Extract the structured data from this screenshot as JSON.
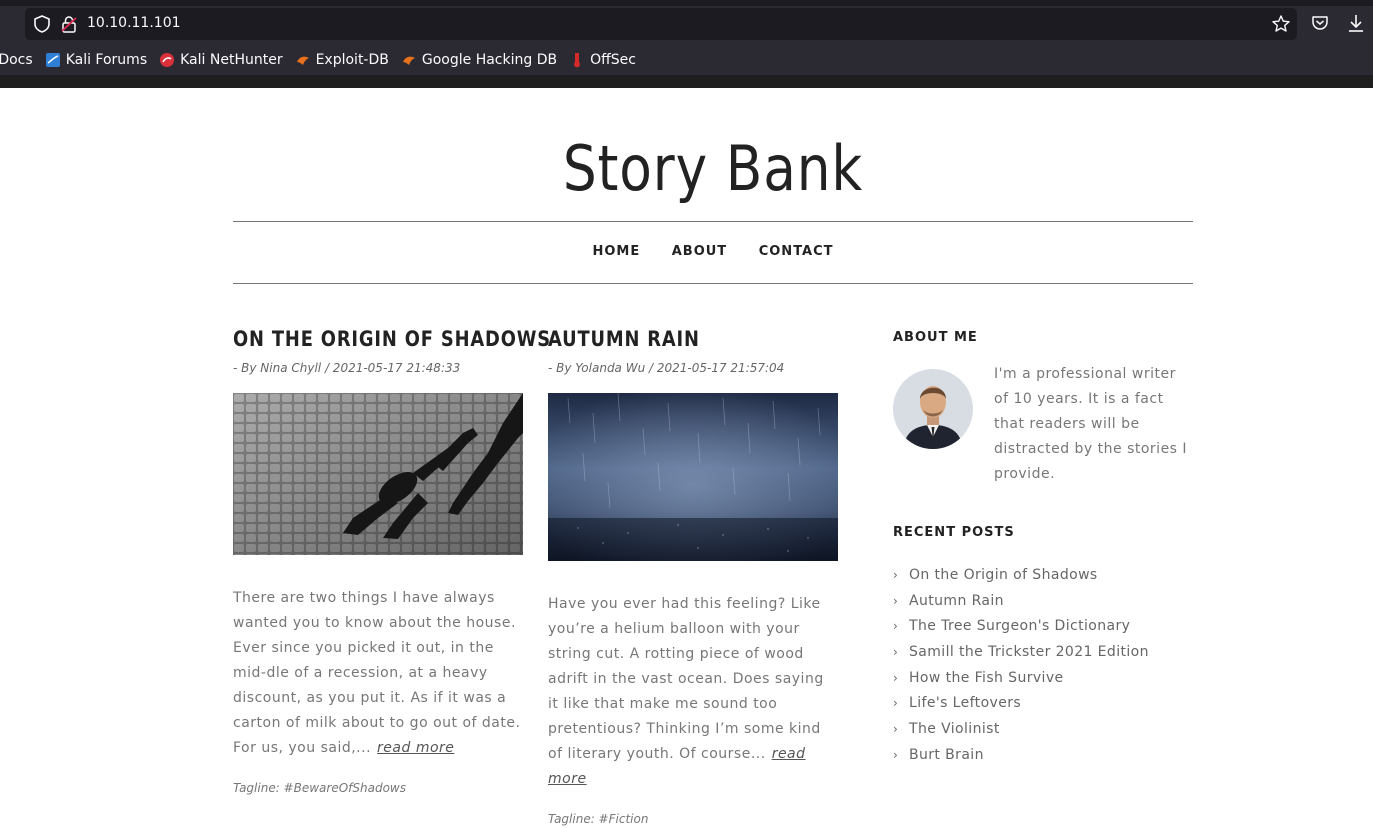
{
  "browser": {
    "url": "10.10.11.101",
    "bookmarks": [
      {
        "label": "i Docs",
        "icon": "kali-docs-icon"
      },
      {
        "label": "Kali Forums",
        "icon": "kali-forums-icon"
      },
      {
        "label": "Kali NetHunter",
        "icon": "kali-nethunter-icon"
      },
      {
        "label": "Exploit-DB",
        "icon": "exploit-db-icon"
      },
      {
        "label": "Google Hacking DB",
        "icon": "ghdb-icon"
      },
      {
        "label": "OffSec",
        "icon": "offsec-icon"
      }
    ]
  },
  "site": {
    "title": "Story Bank",
    "nav": [
      "HOME",
      "ABOUT",
      "CONTACT"
    ]
  },
  "posts": [
    {
      "title": "ON THE ORIGIN OF SHADOWS",
      "meta": "- By Nina Chyll / 2021-05-17 21:48:33",
      "body": "There are two things I have always wanted you to know about the house. Ever since you picked it out, in the mid-dle of a recession, at a heavy discount, as you put it. As if it was a carton of milk about to go out of date. For us, you said,...",
      "more": "read more",
      "tag": "Tagline: #BewareOfShadows",
      "image": "shadow-couple-cobblestones"
    },
    {
      "title": "AUTUMN RAIN",
      "meta": "- By Yolanda Wu / 2021-05-17 21:57:04",
      "body": "Have you ever had this feeling? Like you’re a helium balloon with your string cut. A rotting piece of wood adrift in the vast ocean. Does saying it like that make me sound too pretentious? Thinking I’m some kind of literary youth. Of course...",
      "more": "read more",
      "tag": "Tagline: #Fiction",
      "image": "rain-on-ground"
    }
  ],
  "sidebar": {
    "about_title": "ABOUT ME",
    "about_text": "I'm a professional writer of 10 years. It is a fact that readers will be distracted by the stories I provide.",
    "recent_title": "RECENT POSTS",
    "recent": [
      "On the Origin of Shadows",
      "Autumn Rain",
      "The Tree Surgeon's Dictionary",
      "Samill the Trickster 2021 Edition",
      "How the Fish Survive",
      "Life's Leftovers",
      "The Violinist",
      "Burt Brain"
    ]
  }
}
